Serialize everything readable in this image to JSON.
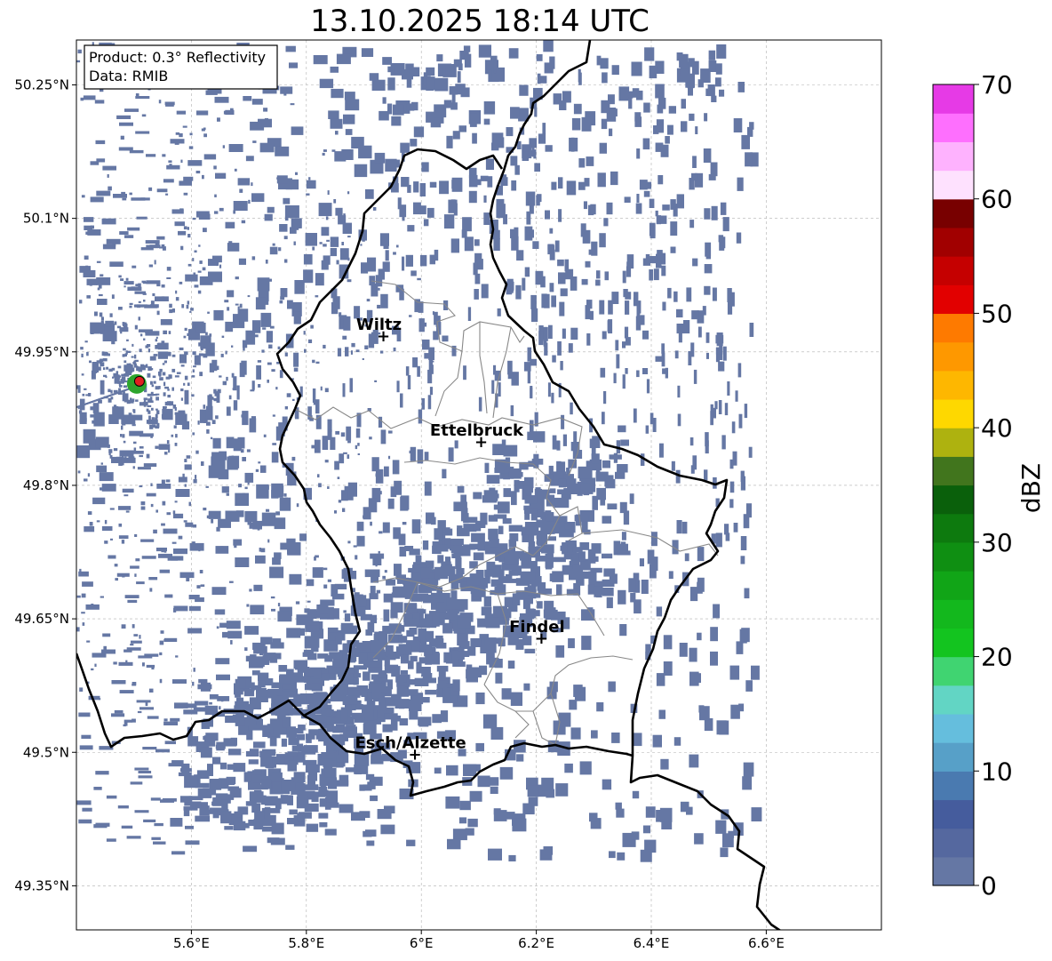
{
  "title": "13.10.2025 18:14 UTC",
  "info_box": {
    "product": "Product: 0.3° Reflectivity",
    "data": "Data: RMIB"
  },
  "map": {
    "lon_range": [
      5.4,
      6.8
    ],
    "lat_range": [
      49.3,
      50.3
    ],
    "lon_ticks": [
      {
        "value": 5.6,
        "label": "5.6°E"
      },
      {
        "value": 5.8,
        "label": "5.8°E"
      },
      {
        "value": 6.0,
        "label": "6°E"
      },
      {
        "value": 6.2,
        "label": "6.2°E"
      },
      {
        "value": 6.4,
        "label": "6.4°E"
      },
      {
        "value": 6.6,
        "label": "6.6°E"
      }
    ],
    "lat_ticks": [
      {
        "value": 50.25,
        "label": "50.25°N"
      },
      {
        "value": 50.1,
        "label": "50.1°N"
      },
      {
        "value": 49.95,
        "label": "49.95°N"
      },
      {
        "value": 49.8,
        "label": "49.8°N"
      },
      {
        "value": 49.65,
        "label": "49.65°N"
      },
      {
        "value": 49.5,
        "label": "49.5°N"
      },
      {
        "value": 49.35,
        "label": "49.35°N"
      }
    ],
    "grid": true,
    "radar_site": {
      "lon": 5.505,
      "lat": 49.914
    },
    "cities": [
      {
        "name": "Wiltz",
        "lon": 5.934,
        "lat": 49.966
      },
      {
        "name": "Ettelbruck",
        "lon": 6.104,
        "lat": 49.847
      },
      {
        "name": "Findel",
        "lon": 6.209,
        "lat": 49.626
      },
      {
        "name": "Esch/Alzette",
        "lon": 5.989,
        "lat": 49.496
      }
    ],
    "echo_color": "#6577a4",
    "border_color": "#000000",
    "canton_color": "#888888"
  },
  "colorbar": {
    "label": "dBZ",
    "min": 0,
    "max": 70,
    "step": 2.5,
    "ticks": [
      {
        "value": 0,
        "label": "0"
      },
      {
        "value": 10,
        "label": "10"
      },
      {
        "value": 20,
        "label": "20"
      },
      {
        "value": 30,
        "label": "30"
      },
      {
        "value": 40,
        "label": "40"
      },
      {
        "value": 50,
        "label": "50"
      },
      {
        "value": 60,
        "label": "60"
      },
      {
        "value": 70,
        "label": "70"
      }
    ],
    "colors": [
      "#6577a4",
      "#55689f",
      "#455c9d",
      "#4a7ab0",
      "#57a0c8",
      "#65bedd",
      "#62d5c4",
      "#40d471",
      "#13c41f",
      "#13b81d",
      "#11a517",
      "#0f8f12",
      "#0d7a0e",
      "#0a600b",
      "#41751d",
      "#aeb20f",
      "#fed800",
      "#feb700",
      "#fe9800",
      "#fe7a00",
      "#e20000",
      "#c50000",
      "#a10000",
      "#780000",
      "#fee1fe",
      "#feb2fe",
      "#fe6ffe",
      "#e63ae6"
    ]
  }
}
